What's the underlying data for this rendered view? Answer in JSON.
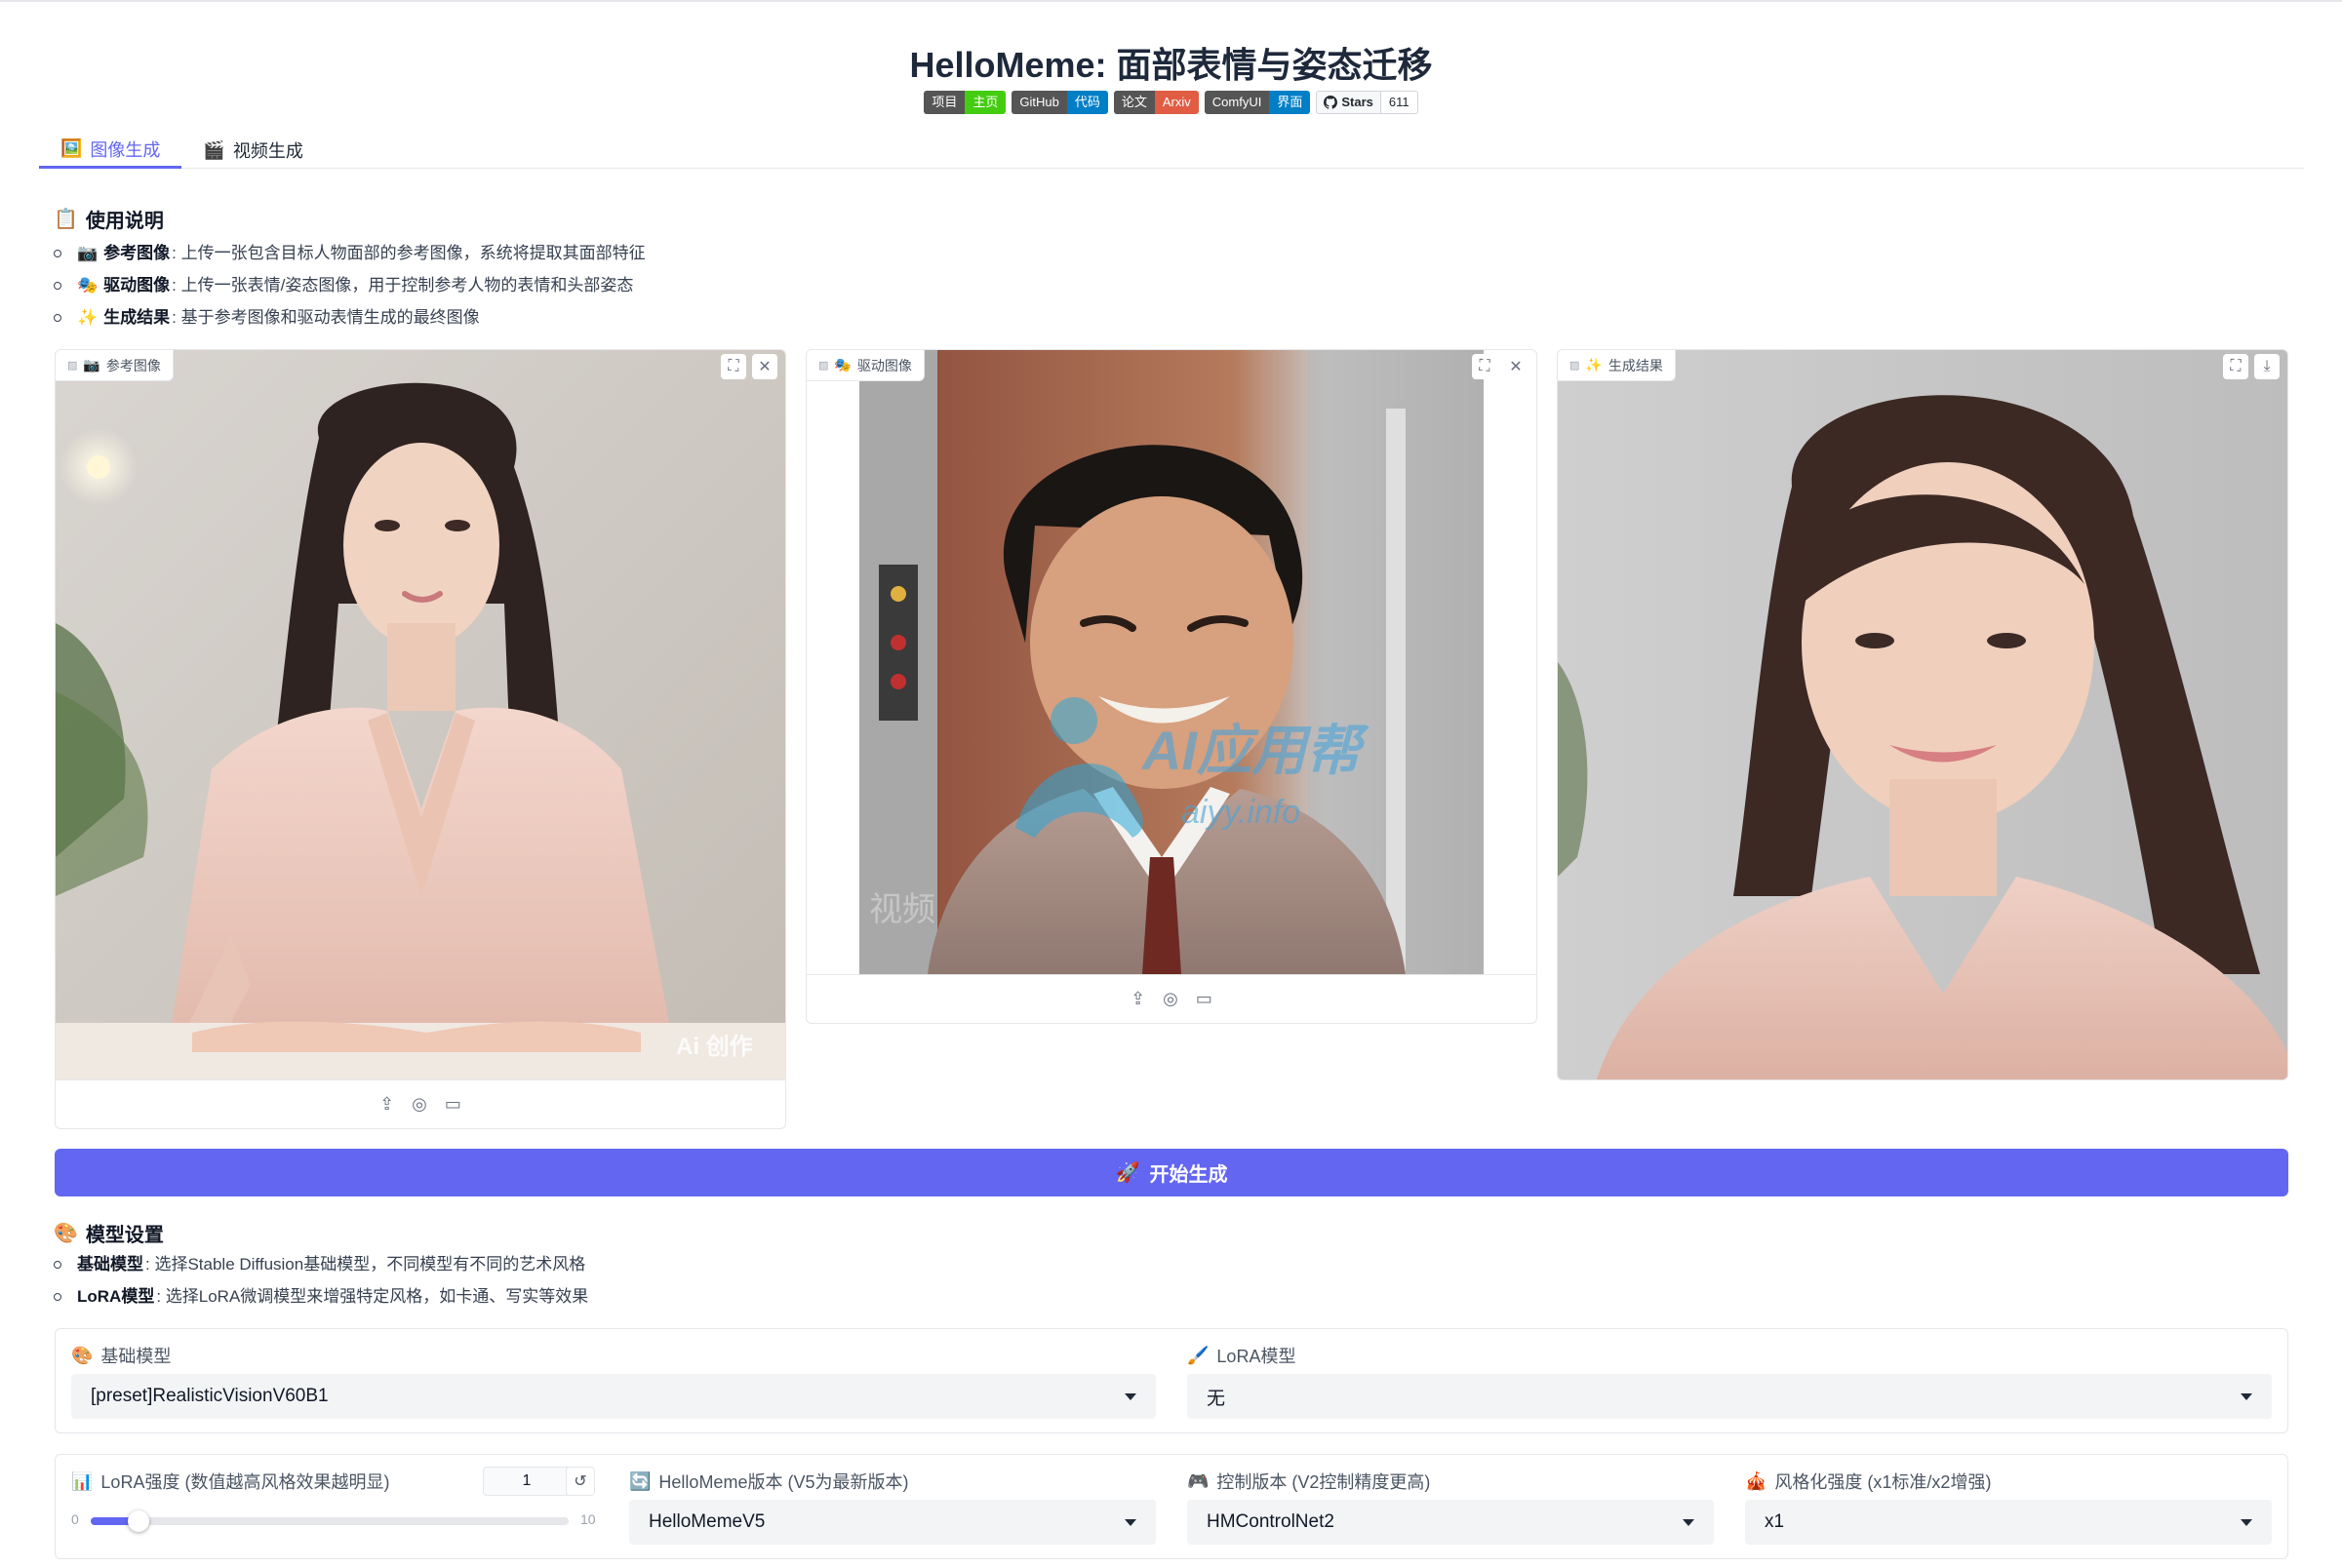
{
  "header": {
    "title": "HelloMeme: 面部表情与姿态迁移",
    "badges": [
      {
        "label": "项目",
        "value": "主页",
        "color": "#44cc11"
      },
      {
        "label": "GitHub",
        "value": "代码",
        "color": "#007ec6"
      },
      {
        "label": "论文",
        "value": "Arxiv",
        "color": "#e05d44"
      },
      {
        "label": "ComfyUI",
        "value": "界面",
        "color": "#007ec6"
      }
    ],
    "github_stars": {
      "label": "Stars",
      "count": "611"
    }
  },
  "tabs": [
    {
      "icon": "🖼️",
      "label": "图像生成",
      "active": true
    },
    {
      "icon": "🎬",
      "label": "视频生成",
      "active": false
    }
  ],
  "instructions": {
    "title": "使用说明",
    "icon": "📋",
    "items": [
      {
        "icon": "📷",
        "term": "参考图像",
        "text": ": 上传一张包含目标人物面部的参考图像，系统将提取其面部特征"
      },
      {
        "icon": "🎭",
        "term": "驱动图像",
        "text": ": 上传一张表情/姿态图像，用于控制参考人物的表情和头部姿态"
      },
      {
        "icon": "✨",
        "term": "生成结果",
        "text": ": 基于参考图像和驱动表情生成的最终图像"
      }
    ]
  },
  "panels": {
    "reference": {
      "icon": "📷",
      "label": "参考图像",
      "watermark": "Ai 创作"
    },
    "driving": {
      "icon": "🎭",
      "label": "驱动图像",
      "watermark_main": "AI应用帮",
      "watermark_sub": "aiyy.info",
      "watermark_small": "视频"
    },
    "result": {
      "icon": "✨",
      "label": "生成结果"
    }
  },
  "generate_button": {
    "icon": "🚀",
    "label": "开始生成"
  },
  "model_settings": {
    "title": "模型设置",
    "icon": "🎨",
    "items": [
      {
        "term": "基础模型",
        "text": ": 选择Stable Diffusion基础模型，不同模型有不同的艺术风格"
      },
      {
        "term": "LoRA模型",
        "text": ": 选择LoRA微调模型来增强特定风格，如卡通、写实等效果"
      }
    ]
  },
  "fields": {
    "base_model": {
      "icon": "🎨",
      "label": "基础模型",
      "value": "[preset]RealisticVisionV60B1"
    },
    "lora_model": {
      "icon": "🖌️",
      "label": "LoRA模型",
      "value": "无"
    },
    "lora_strength": {
      "icon": "📊",
      "label": "LoRA强度 (数值越高风格效果越明显)",
      "value": "1",
      "min": "0",
      "max": "10",
      "level": 0.1
    },
    "hellomeme_version": {
      "icon": "🔄",
      "label": "HelloMeme版本 (V5为最新版本)",
      "value": "HelloMemeV5"
    },
    "control_version": {
      "icon": "🎮",
      "label": "控制版本 (V2控制精度更高)",
      "value": "HMControlNet2"
    },
    "stylize": {
      "icon": "🎪",
      "label": "风格化强度 (x1标准/x2增强)",
      "value": "x1"
    }
  }
}
